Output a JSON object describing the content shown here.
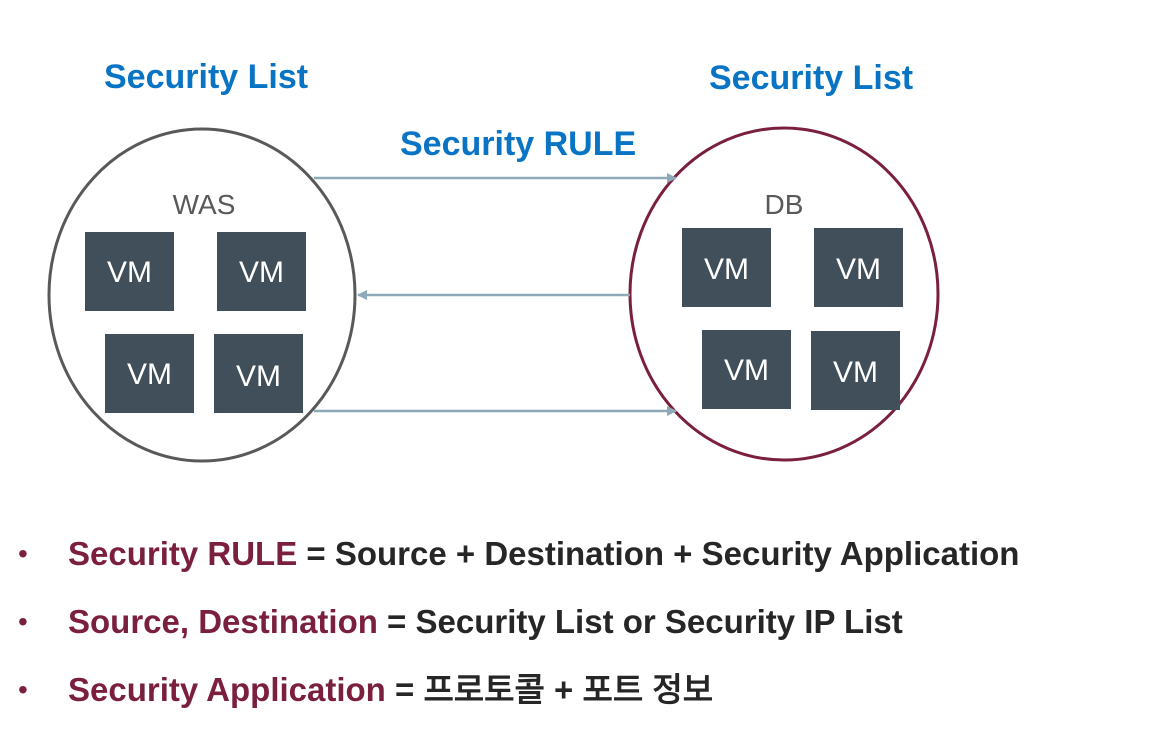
{
  "diagram": {
    "left_title": "Security List",
    "right_title": "Security List",
    "rule_label": "Security RULE",
    "left_group": {
      "label": "WAS",
      "vms": [
        "VM",
        "VM",
        "VM",
        "VM"
      ]
    },
    "right_group": {
      "label": "DB",
      "vms": [
        "VM",
        "VM",
        "VM",
        "VM"
      ]
    }
  },
  "bullets": [
    {
      "term": "Security RULE",
      "definition": " = Source + Destination + Security Application"
    },
    {
      "term": "Source, Destination",
      "definition": " = Security List or Security IP List"
    },
    {
      "term": "Security Application",
      "definition": " =  프로토콜 + 포트 정보"
    }
  ],
  "colors": {
    "title_blue": "#0a74c4",
    "term_maroon": "#7a1f3d",
    "vm_fill": "#404f59",
    "left_circle_stroke": "#595959",
    "right_circle_stroke": "#7a1f3d",
    "arrow": "#8eaab8"
  },
  "bullet_glyph": "•"
}
